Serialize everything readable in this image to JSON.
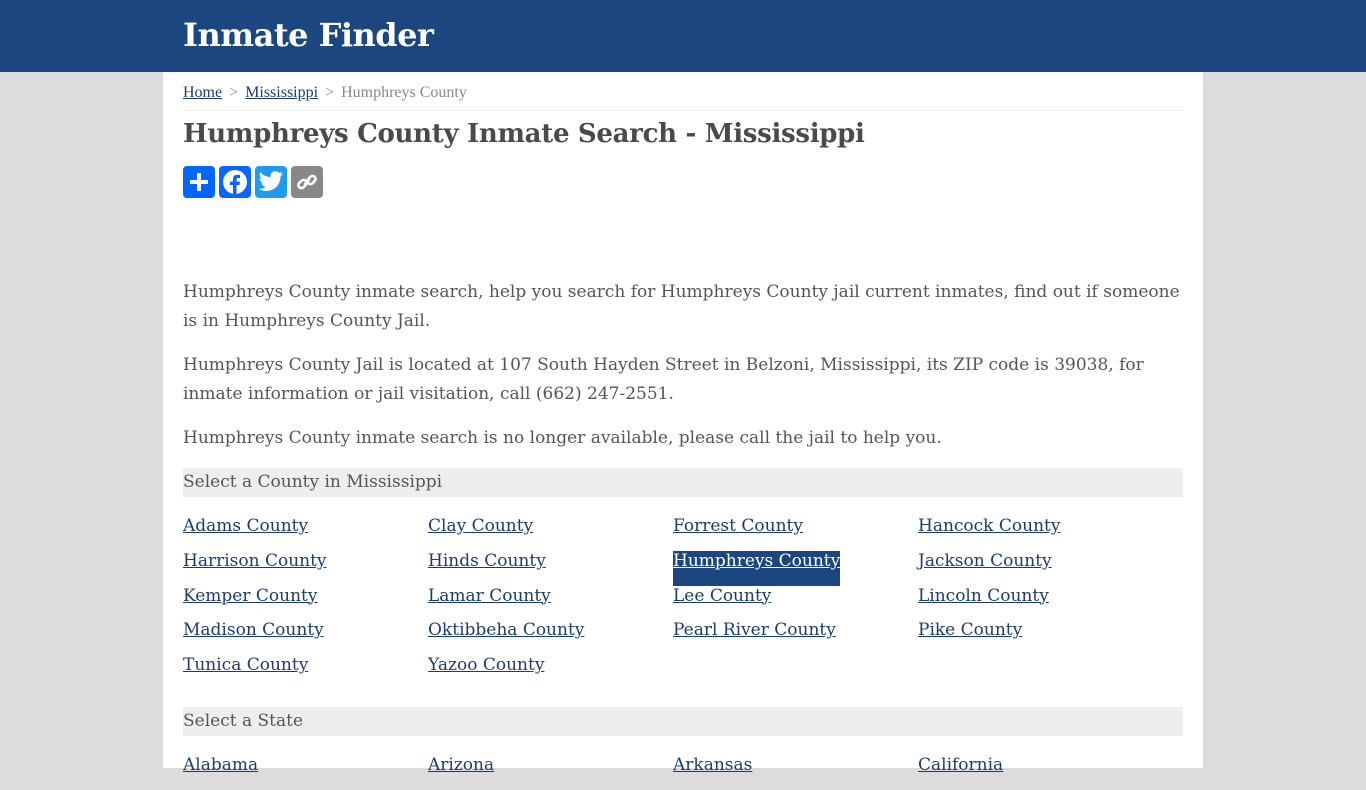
{
  "header": {
    "site_title": "Inmate Finder"
  },
  "breadcrumb": {
    "items": [
      {
        "label": "Home",
        "link": true
      },
      {
        "label": "Mississippi",
        "link": true
      },
      {
        "label": "Humphreys County",
        "link": false
      }
    ],
    "separator": ">"
  },
  "page_title": "Humphreys County Inmate Search - Mississippi",
  "share": {
    "buttons": [
      {
        "name": "share-add",
        "icon": "plus-icon",
        "color": "#0166ff"
      },
      {
        "name": "share-facebook",
        "icon": "facebook-icon",
        "color": "#0866ff"
      },
      {
        "name": "share-twitter",
        "icon": "twitter-icon",
        "color": "#1d9bf0"
      },
      {
        "name": "share-copy-link",
        "icon": "link-icon",
        "color": "#888888"
      }
    ]
  },
  "paragraphs": [
    "Humphreys County inmate search, help you search for Humphreys County jail current inmates, find out if someone is in Humphreys County Jail.",
    "Humphreys County Jail is located at 107 South Hayden Street in Belzoni, Mississippi, its ZIP code is 39038, for inmate information or jail visitation, call (662) 247-2551.",
    "Humphreys County inmate search is no longer available, please call the jail to help you."
  ],
  "county_section": {
    "heading": "Select a County in Mississippi",
    "counties": [
      "Adams County",
      "Clay County",
      "Forrest County",
      "Hancock County",
      "Harrison County",
      "Hinds County",
      "Humphreys County",
      "Jackson County",
      "Kemper County",
      "Lamar County",
      "Lee County",
      "Lincoln County",
      "Madison County",
      "Oktibbeha County",
      "Pearl River County",
      "Pike County",
      "Tunica County",
      "Yazoo County"
    ],
    "active": "Humphreys County"
  },
  "state_section": {
    "heading": "Select a State",
    "states": [
      "Alabama",
      "Arizona",
      "Arkansas",
      "California"
    ]
  },
  "colors": {
    "header_bg": "#1c4680",
    "link": "#1c3c6c",
    "section_bg": "#eeeeee"
  }
}
